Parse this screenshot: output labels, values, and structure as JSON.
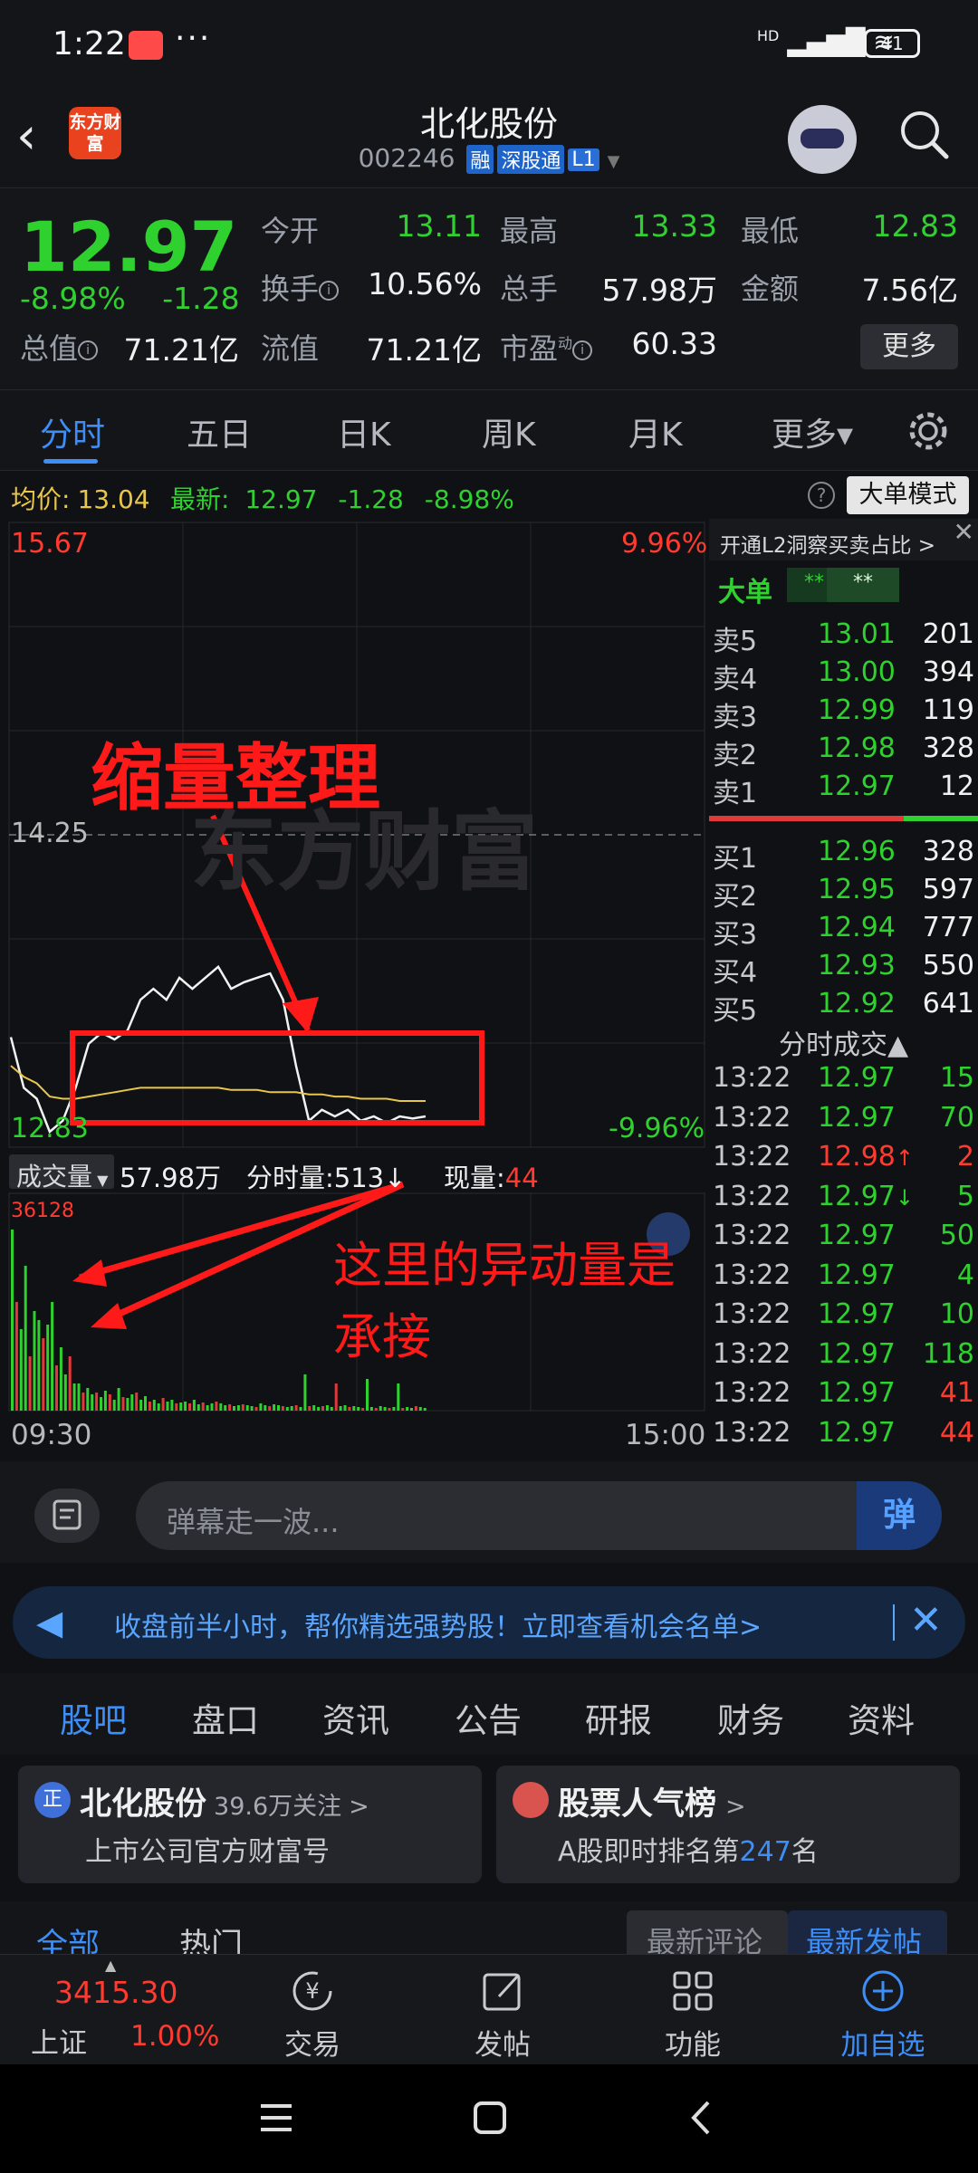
{
  "status_bar": {
    "time": "1:22",
    "more": "···",
    "network": "HD",
    "battery": "41"
  },
  "header": {
    "logo_text": "东方财富",
    "title": "北化股份",
    "code": "002246",
    "tags": [
      "融",
      "深股通",
      "L1"
    ]
  },
  "quote": {
    "price": "12.97",
    "change_pct": "-8.98%",
    "change": "-1.28",
    "fields": [
      {
        "label": "今开",
        "value": "13.11",
        "color": "#2ed12e"
      },
      {
        "label": "最高",
        "value": "13.33",
        "color": "#2ed12e"
      },
      {
        "label": "最低",
        "value": "12.83",
        "color": "#2ed12e"
      },
      {
        "label": "换手",
        "value": "10.56%",
        "color": "#f0f0f0"
      },
      {
        "label": "总手",
        "value": "57.98万",
        "color": "#f0f0f0"
      },
      {
        "label": "金额",
        "value": "7.56亿",
        "color": "#f0f0f0"
      },
      {
        "label": "总值",
        "value": "71.21亿",
        "color": "#f0f0f0"
      },
      {
        "label": "流值",
        "value": "71.21亿",
        "color": "#f0f0f0"
      },
      {
        "label": "市盈",
        "value": "60.33",
        "color": "#f0f0f0"
      }
    ],
    "pe_super": "动",
    "more_button": "更多"
  },
  "tabs": [
    "分时",
    "五日",
    "日K",
    "周K",
    "月K",
    "更多▾"
  ],
  "avg_row": {
    "avg_label": "均价:",
    "avg_value": "13.04",
    "latest_label": "最新:",
    "latest_value": "12.97",
    "change": "-1.28",
    "change_pct": "-8.98%",
    "help": "?",
    "mode_button": "大单模式"
  },
  "chart": {
    "watermark": "东方财富",
    "y_top": "15.67",
    "y_mid": "14.25",
    "y_bottom": "12.83",
    "pct_top": "9.96%",
    "pct_bottom": "-9.96%",
    "annotation_top": "缩量整理",
    "annotation_bottom": "这里的异动量是承接",
    "volume_label": "成交量",
    "volume_total": "57.98万",
    "minute_volume_label": "分时量:",
    "minute_volume": "513",
    "minute_volume_arrow": "↓",
    "current_volume_label": "现量:",
    "current_volume": "44",
    "volume_max": "36128",
    "time_start": "09:30",
    "time_end": "15:00"
  },
  "chart_data": {
    "type": "line",
    "ylim": [
      12.83,
      15.67
    ],
    "xlabel": "",
    "ylabel": "",
    "x": [
      "09:30",
      "15:00"
    ],
    "series": [
      {
        "values": [
          13.33,
          13.1,
          13.05,
          12.9,
          12.95,
          13.1,
          13.3,
          13.35,
          13.32,
          13.36,
          13.5,
          13.55,
          13.5,
          13.6,
          13.55,
          13.6,
          13.65,
          13.55,
          13.58,
          13.6,
          13.62,
          13.5,
          13.2,
          12.95,
          13.0,
          12.97,
          13.0,
          12.95,
          12.97,
          12.94,
          12.97,
          12.96,
          12.97
        ]
      },
      {
        "values": [
          13.2,
          13.15,
          13.12,
          13.06,
          13.05,
          13.05,
          13.06,
          13.07,
          13.08,
          13.09,
          13.1,
          13.1,
          13.1,
          13.1,
          13.1,
          13.1,
          13.1,
          13.09,
          13.09,
          13.09,
          13.08,
          13.08,
          13.08,
          13.07,
          13.07,
          13.06,
          13.06,
          13.05,
          13.05,
          13.05,
          13.04,
          13.04,
          13.04
        ]
      }
    ]
  },
  "orderbook": {
    "side_title": "开通L2洞察买卖占比 >",
    "big_order": "大单",
    "big_vals": [
      "**",
      "**"
    ],
    "sells": [
      {
        "label": "卖5",
        "price": "13.01",
        "vol": "201"
      },
      {
        "label": "卖4",
        "price": "13.00",
        "vol": "394"
      },
      {
        "label": "卖3",
        "price": "12.99",
        "vol": "119"
      },
      {
        "label": "卖2",
        "price": "12.98",
        "vol": "328"
      },
      {
        "label": "卖1",
        "price": "12.97",
        "vol": "12"
      }
    ],
    "buys": [
      {
        "label": "买1",
        "price": "12.96",
        "vol": "328"
      },
      {
        "label": "买2",
        "price": "12.95",
        "vol": "597"
      },
      {
        "label": "买3",
        "price": "12.94",
        "vol": "777"
      },
      {
        "label": "买4",
        "price": "12.93",
        "vol": "550"
      },
      {
        "label": "买5",
        "price": "12.92",
        "vol": "641"
      }
    ],
    "ticks_title": "分时成交▲",
    "ticks": [
      {
        "time": "13:22",
        "price": "12.97",
        "mark": "",
        "vol": "15",
        "vcolor": "#2ed12e"
      },
      {
        "time": "13:22",
        "price": "12.97",
        "mark": "",
        "vol": "70",
        "vcolor": "#2ed12e"
      },
      {
        "time": "13:22",
        "price": "12.98",
        "mark": "↑",
        "vol": "2",
        "vcolor": "#ff3b30"
      },
      {
        "time": "13:22",
        "price": "12.97",
        "mark": "↓",
        "vol": "5",
        "vcolor": "#2ed12e"
      },
      {
        "time": "13:22",
        "price": "12.97",
        "mark": "",
        "vol": "50",
        "vcolor": "#2ed12e"
      },
      {
        "time": "13:22",
        "price": "12.97",
        "mark": "",
        "vol": "4",
        "vcolor": "#2ed12e"
      },
      {
        "time": "13:22",
        "price": "12.97",
        "mark": "",
        "vol": "10",
        "vcolor": "#2ed12e"
      },
      {
        "time": "13:22",
        "price": "12.97",
        "mark": "",
        "vol": "118",
        "vcolor": "#2ed12e"
      },
      {
        "time": "13:22",
        "price": "12.97",
        "mark": "",
        "vol": "41",
        "vcolor": "#ff3b30"
      },
      {
        "time": "13:22",
        "price": "12.97",
        "mark": "",
        "vol": "44",
        "vcolor": "#ff3b30"
      }
    ]
  },
  "danmu": {
    "placeholder": "弹幕走一波...",
    "button": "弹"
  },
  "banner": {
    "text": "收盘前半小时，帮你精选强势股！立即查看机会名单>"
  },
  "bottom_tabs": [
    "股吧",
    "盘口",
    "资讯",
    "公告",
    "研报",
    "财务",
    "资料"
  ],
  "cards": [
    {
      "icon_text": "正",
      "title": "北化股份",
      "followers": "39.6万关注",
      "chev": ">",
      "sub": "上市公司官方财富号"
    },
    {
      "icon_text": "",
      "title": "股票人气榜",
      "chev": ">",
      "sub_a": "A股即时排名第",
      "rank": "247",
      "sub_b": "名"
    }
  ],
  "sub_tabs": [
    "全部",
    "热门",
    "最新评论",
    "最新发帖"
  ],
  "bottom_nav": {
    "index_value": "3415.30",
    "index_name": "上证",
    "index_pct": "1.00%",
    "items": [
      "交易",
      "发帖",
      "功能",
      "加自选"
    ]
  }
}
